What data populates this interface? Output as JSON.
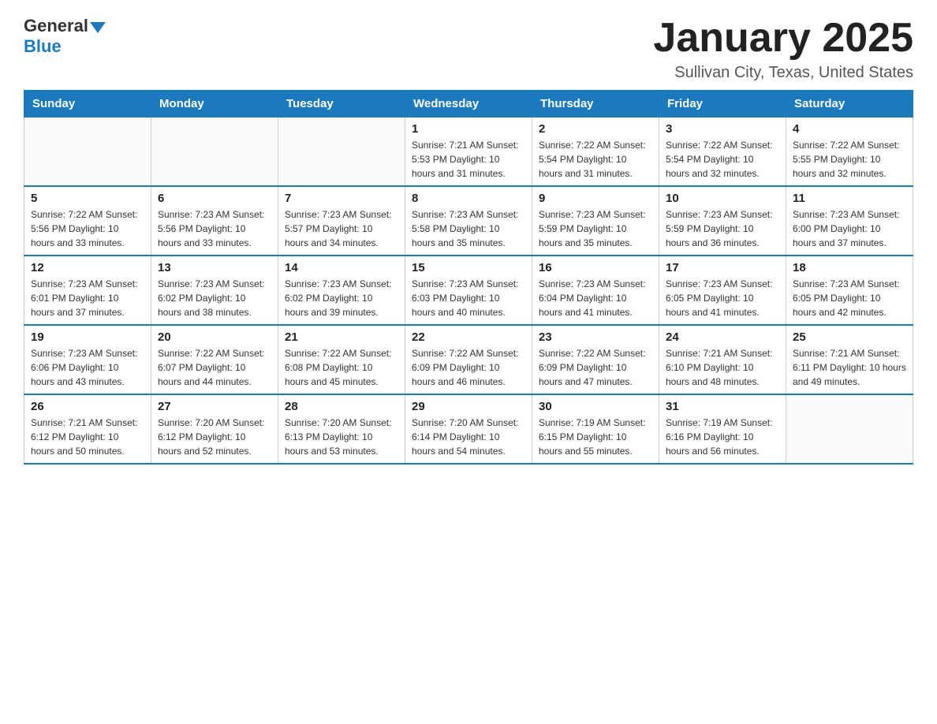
{
  "header": {
    "logo_general": "General",
    "logo_blue": "Blue",
    "month_title": "January 2025",
    "location": "Sullivan City, Texas, United States"
  },
  "days_of_week": [
    "Sunday",
    "Monday",
    "Tuesday",
    "Wednesday",
    "Thursday",
    "Friday",
    "Saturday"
  ],
  "weeks": [
    [
      {
        "day": "",
        "info": ""
      },
      {
        "day": "",
        "info": ""
      },
      {
        "day": "",
        "info": ""
      },
      {
        "day": "1",
        "info": "Sunrise: 7:21 AM\nSunset: 5:53 PM\nDaylight: 10 hours\nand 31 minutes."
      },
      {
        "day": "2",
        "info": "Sunrise: 7:22 AM\nSunset: 5:54 PM\nDaylight: 10 hours\nand 31 minutes."
      },
      {
        "day": "3",
        "info": "Sunrise: 7:22 AM\nSunset: 5:54 PM\nDaylight: 10 hours\nand 32 minutes."
      },
      {
        "day": "4",
        "info": "Sunrise: 7:22 AM\nSunset: 5:55 PM\nDaylight: 10 hours\nand 32 minutes."
      }
    ],
    [
      {
        "day": "5",
        "info": "Sunrise: 7:22 AM\nSunset: 5:56 PM\nDaylight: 10 hours\nand 33 minutes."
      },
      {
        "day": "6",
        "info": "Sunrise: 7:23 AM\nSunset: 5:56 PM\nDaylight: 10 hours\nand 33 minutes."
      },
      {
        "day": "7",
        "info": "Sunrise: 7:23 AM\nSunset: 5:57 PM\nDaylight: 10 hours\nand 34 minutes."
      },
      {
        "day": "8",
        "info": "Sunrise: 7:23 AM\nSunset: 5:58 PM\nDaylight: 10 hours\nand 35 minutes."
      },
      {
        "day": "9",
        "info": "Sunrise: 7:23 AM\nSunset: 5:59 PM\nDaylight: 10 hours\nand 35 minutes."
      },
      {
        "day": "10",
        "info": "Sunrise: 7:23 AM\nSunset: 5:59 PM\nDaylight: 10 hours\nand 36 minutes."
      },
      {
        "day": "11",
        "info": "Sunrise: 7:23 AM\nSunset: 6:00 PM\nDaylight: 10 hours\nand 37 minutes."
      }
    ],
    [
      {
        "day": "12",
        "info": "Sunrise: 7:23 AM\nSunset: 6:01 PM\nDaylight: 10 hours\nand 37 minutes."
      },
      {
        "day": "13",
        "info": "Sunrise: 7:23 AM\nSunset: 6:02 PM\nDaylight: 10 hours\nand 38 minutes."
      },
      {
        "day": "14",
        "info": "Sunrise: 7:23 AM\nSunset: 6:02 PM\nDaylight: 10 hours\nand 39 minutes."
      },
      {
        "day": "15",
        "info": "Sunrise: 7:23 AM\nSunset: 6:03 PM\nDaylight: 10 hours\nand 40 minutes."
      },
      {
        "day": "16",
        "info": "Sunrise: 7:23 AM\nSunset: 6:04 PM\nDaylight: 10 hours\nand 41 minutes."
      },
      {
        "day": "17",
        "info": "Sunrise: 7:23 AM\nSunset: 6:05 PM\nDaylight: 10 hours\nand 41 minutes."
      },
      {
        "day": "18",
        "info": "Sunrise: 7:23 AM\nSunset: 6:05 PM\nDaylight: 10 hours\nand 42 minutes."
      }
    ],
    [
      {
        "day": "19",
        "info": "Sunrise: 7:23 AM\nSunset: 6:06 PM\nDaylight: 10 hours\nand 43 minutes."
      },
      {
        "day": "20",
        "info": "Sunrise: 7:22 AM\nSunset: 6:07 PM\nDaylight: 10 hours\nand 44 minutes."
      },
      {
        "day": "21",
        "info": "Sunrise: 7:22 AM\nSunset: 6:08 PM\nDaylight: 10 hours\nand 45 minutes."
      },
      {
        "day": "22",
        "info": "Sunrise: 7:22 AM\nSunset: 6:09 PM\nDaylight: 10 hours\nand 46 minutes."
      },
      {
        "day": "23",
        "info": "Sunrise: 7:22 AM\nSunset: 6:09 PM\nDaylight: 10 hours\nand 47 minutes."
      },
      {
        "day": "24",
        "info": "Sunrise: 7:21 AM\nSunset: 6:10 PM\nDaylight: 10 hours\nand 48 minutes."
      },
      {
        "day": "25",
        "info": "Sunrise: 7:21 AM\nSunset: 6:11 PM\nDaylight: 10 hours\nand 49 minutes."
      }
    ],
    [
      {
        "day": "26",
        "info": "Sunrise: 7:21 AM\nSunset: 6:12 PM\nDaylight: 10 hours\nand 50 minutes."
      },
      {
        "day": "27",
        "info": "Sunrise: 7:20 AM\nSunset: 6:12 PM\nDaylight: 10 hours\nand 52 minutes."
      },
      {
        "day": "28",
        "info": "Sunrise: 7:20 AM\nSunset: 6:13 PM\nDaylight: 10 hours\nand 53 minutes."
      },
      {
        "day": "29",
        "info": "Sunrise: 7:20 AM\nSunset: 6:14 PM\nDaylight: 10 hours\nand 54 minutes."
      },
      {
        "day": "30",
        "info": "Sunrise: 7:19 AM\nSunset: 6:15 PM\nDaylight: 10 hours\nand 55 minutes."
      },
      {
        "day": "31",
        "info": "Sunrise: 7:19 AM\nSunset: 6:16 PM\nDaylight: 10 hours\nand 56 minutes."
      },
      {
        "day": "",
        "info": ""
      }
    ]
  ]
}
